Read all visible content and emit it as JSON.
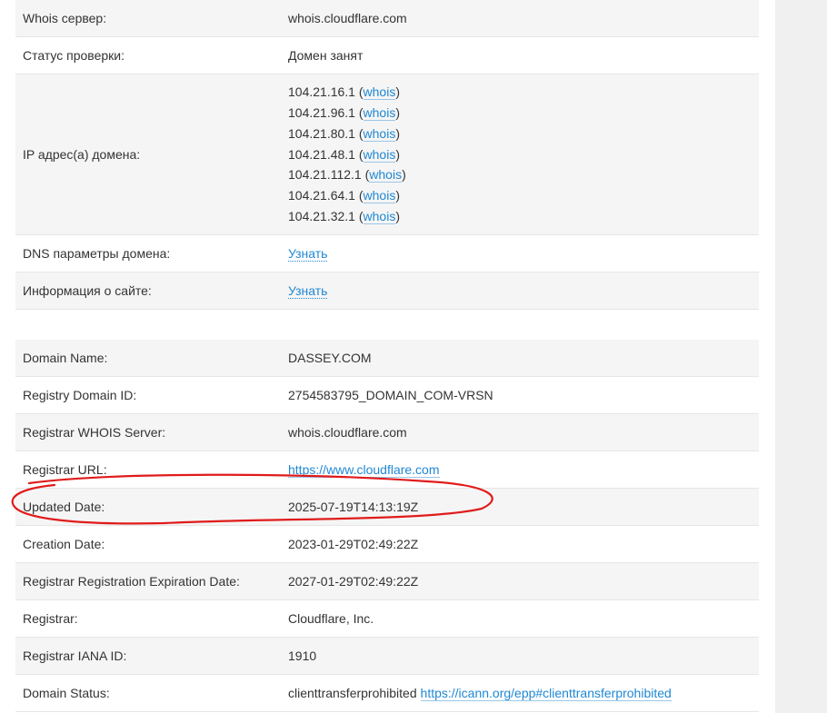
{
  "table1": {
    "whois_server": {
      "label": "Whois сервер:",
      "value": "whois.cloudflare.com"
    },
    "status": {
      "label": "Статус проверки:",
      "value": "Домен занят"
    },
    "ip": {
      "label": "IP адрес(а) домена:",
      "items": [
        {
          "ip": "104.21.16.1",
          "link": "whois"
        },
        {
          "ip": "104.21.96.1",
          "link": "whois"
        },
        {
          "ip": "104.21.80.1",
          "link": "whois"
        },
        {
          "ip": "104.21.48.1",
          "link": "whois"
        },
        {
          "ip": "104.21.112.1",
          "link": "whois"
        },
        {
          "ip": "104.21.64.1",
          "link": "whois"
        },
        {
          "ip": "104.21.32.1",
          "link": "whois"
        }
      ]
    },
    "dns": {
      "label": "DNS параметры домена:",
      "link": "Узнать"
    },
    "site_info": {
      "label": "Информация о сайте:",
      "link": "Узнать"
    }
  },
  "table2": {
    "domain_name": {
      "label": "Domain Name:",
      "value": "DASSEY.COM"
    },
    "registry_id": {
      "label": "Registry Domain ID:",
      "value": "2754583795_DOMAIN_COM-VRSN"
    },
    "registrar_whois": {
      "label": "Registrar WHOIS Server:",
      "value": "whois.cloudflare.com"
    },
    "registrar_url": {
      "label": "Registrar URL:",
      "link": "https://www.cloudflare.com"
    },
    "updated": {
      "label": "Updated Date:",
      "value": "2025-07-19T14:13:19Z"
    },
    "creation": {
      "label": "Creation Date:",
      "value": "2023-01-29T02:49:22Z"
    },
    "expiration": {
      "label": "Registrar Registration Expiration Date:",
      "value": "2027-01-29T02:49:22Z"
    },
    "registrar": {
      "label": "Registrar:",
      "value": "Cloudflare, Inc."
    },
    "iana": {
      "label": "Registrar IANA ID:",
      "value": "1910"
    },
    "status": {
      "label": "Domain Status:",
      "value": "clienttransferprohibited",
      "link": "https://icann.org/epp#clienttransferprohibited"
    }
  },
  "colors": {
    "link": "#1f88d4",
    "annotation": "#e01b1b",
    "row_alt": "#f5f5f5"
  }
}
